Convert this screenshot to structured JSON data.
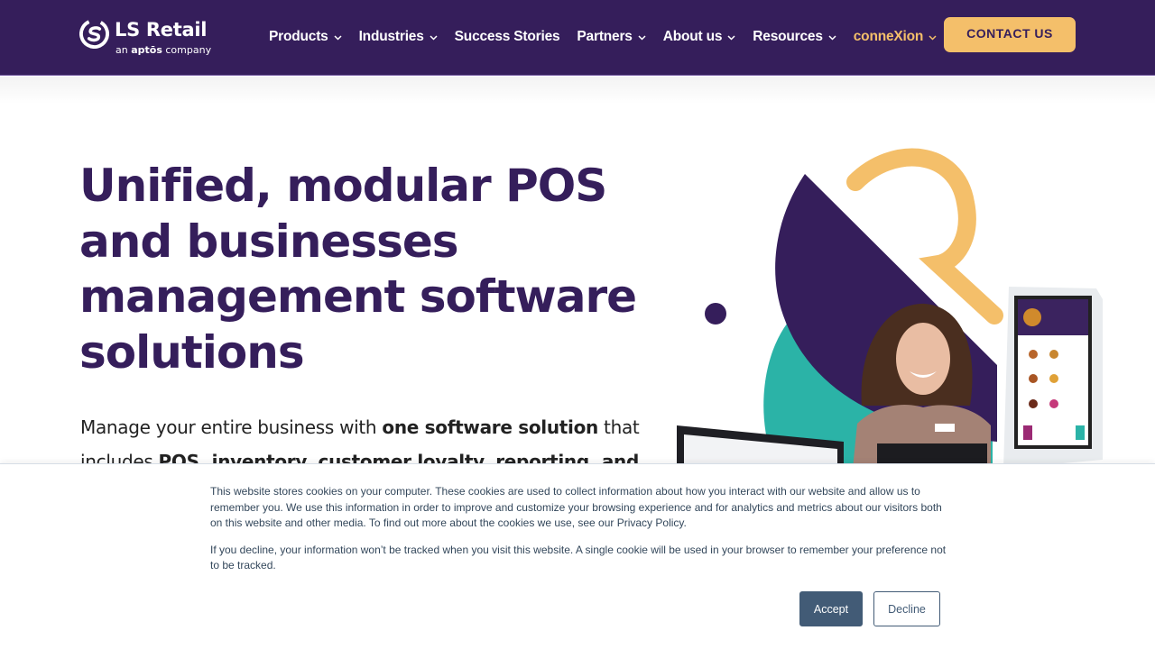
{
  "brand": {
    "name": "LS Retail",
    "tagline_prefix": "an ",
    "tagline_brand": "aptōs",
    "tagline_suffix": " company",
    "colors": {
      "primary": "#351e5b",
      "accent": "#f4bf6a",
      "teal": "#2bb3a7"
    }
  },
  "nav": {
    "items": [
      {
        "label": "Products",
        "has_dropdown": true
      },
      {
        "label": "Industries",
        "has_dropdown": true
      },
      {
        "label": "Success Stories",
        "has_dropdown": false
      },
      {
        "label": "Partners",
        "has_dropdown": true
      },
      {
        "label": "About us",
        "has_dropdown": true
      },
      {
        "label": "Resources",
        "has_dropdown": true
      },
      {
        "label": "conneXion",
        "has_dropdown": true,
        "highlighted": true
      }
    ],
    "cta_label": "CONTACT US"
  },
  "hero": {
    "title": "Unified, modular POS and businesses management software solutions",
    "desc": {
      "part1": "Manage your entire business with ",
      "bold1": "one software solution",
      "part2": " that includes ",
      "bold2": "POS, inventory, customer loyalty, reporting, and"
    },
    "image_alt": "Smiling woman with POS screen and self-service kiosk"
  },
  "cookie_banner": {
    "paragraph1": "This website stores cookies on your computer. These cookies are used to collect information about how you interact with our website and allow us to remember you. We use this information in order to improve and customize your browsing experience and for analytics and metrics about our visitors both on this website and other media. To find out more about the cookies we use, see our Privacy Policy.",
    "paragraph2": "If you decline, your information won’t be tracked when you visit this website. A single cookie will be used in your browser to remember your preference not to be tracked.",
    "accept_label": "Accept",
    "decline_label": "Decline"
  }
}
